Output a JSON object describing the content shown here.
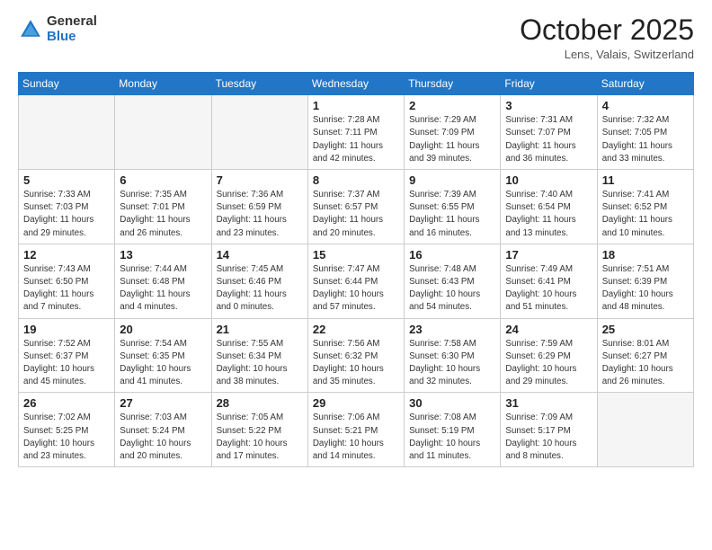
{
  "header": {
    "logo_general": "General",
    "logo_blue": "Blue",
    "month_title": "October 2025",
    "location": "Lens, Valais, Switzerland"
  },
  "weekdays": [
    "Sunday",
    "Monday",
    "Tuesday",
    "Wednesday",
    "Thursday",
    "Friday",
    "Saturday"
  ],
  "weeks": [
    [
      {
        "day": "",
        "info": ""
      },
      {
        "day": "",
        "info": ""
      },
      {
        "day": "",
        "info": ""
      },
      {
        "day": "1",
        "info": "Sunrise: 7:28 AM\nSunset: 7:11 PM\nDaylight: 11 hours\nand 42 minutes."
      },
      {
        "day": "2",
        "info": "Sunrise: 7:29 AM\nSunset: 7:09 PM\nDaylight: 11 hours\nand 39 minutes."
      },
      {
        "day": "3",
        "info": "Sunrise: 7:31 AM\nSunset: 7:07 PM\nDaylight: 11 hours\nand 36 minutes."
      },
      {
        "day": "4",
        "info": "Sunrise: 7:32 AM\nSunset: 7:05 PM\nDaylight: 11 hours\nand 33 minutes."
      }
    ],
    [
      {
        "day": "5",
        "info": "Sunrise: 7:33 AM\nSunset: 7:03 PM\nDaylight: 11 hours\nand 29 minutes."
      },
      {
        "day": "6",
        "info": "Sunrise: 7:35 AM\nSunset: 7:01 PM\nDaylight: 11 hours\nand 26 minutes."
      },
      {
        "day": "7",
        "info": "Sunrise: 7:36 AM\nSunset: 6:59 PM\nDaylight: 11 hours\nand 23 minutes."
      },
      {
        "day": "8",
        "info": "Sunrise: 7:37 AM\nSunset: 6:57 PM\nDaylight: 11 hours\nand 20 minutes."
      },
      {
        "day": "9",
        "info": "Sunrise: 7:39 AM\nSunset: 6:55 PM\nDaylight: 11 hours\nand 16 minutes."
      },
      {
        "day": "10",
        "info": "Sunrise: 7:40 AM\nSunset: 6:54 PM\nDaylight: 11 hours\nand 13 minutes."
      },
      {
        "day": "11",
        "info": "Sunrise: 7:41 AM\nSunset: 6:52 PM\nDaylight: 11 hours\nand 10 minutes."
      }
    ],
    [
      {
        "day": "12",
        "info": "Sunrise: 7:43 AM\nSunset: 6:50 PM\nDaylight: 11 hours\nand 7 minutes."
      },
      {
        "day": "13",
        "info": "Sunrise: 7:44 AM\nSunset: 6:48 PM\nDaylight: 11 hours\nand 4 minutes."
      },
      {
        "day": "14",
        "info": "Sunrise: 7:45 AM\nSunset: 6:46 PM\nDaylight: 11 hours\nand 0 minutes."
      },
      {
        "day": "15",
        "info": "Sunrise: 7:47 AM\nSunset: 6:44 PM\nDaylight: 10 hours\nand 57 minutes."
      },
      {
        "day": "16",
        "info": "Sunrise: 7:48 AM\nSunset: 6:43 PM\nDaylight: 10 hours\nand 54 minutes."
      },
      {
        "day": "17",
        "info": "Sunrise: 7:49 AM\nSunset: 6:41 PM\nDaylight: 10 hours\nand 51 minutes."
      },
      {
        "day": "18",
        "info": "Sunrise: 7:51 AM\nSunset: 6:39 PM\nDaylight: 10 hours\nand 48 minutes."
      }
    ],
    [
      {
        "day": "19",
        "info": "Sunrise: 7:52 AM\nSunset: 6:37 PM\nDaylight: 10 hours\nand 45 minutes."
      },
      {
        "day": "20",
        "info": "Sunrise: 7:54 AM\nSunset: 6:35 PM\nDaylight: 10 hours\nand 41 minutes."
      },
      {
        "day": "21",
        "info": "Sunrise: 7:55 AM\nSunset: 6:34 PM\nDaylight: 10 hours\nand 38 minutes."
      },
      {
        "day": "22",
        "info": "Sunrise: 7:56 AM\nSunset: 6:32 PM\nDaylight: 10 hours\nand 35 minutes."
      },
      {
        "day": "23",
        "info": "Sunrise: 7:58 AM\nSunset: 6:30 PM\nDaylight: 10 hours\nand 32 minutes."
      },
      {
        "day": "24",
        "info": "Sunrise: 7:59 AM\nSunset: 6:29 PM\nDaylight: 10 hours\nand 29 minutes."
      },
      {
        "day": "25",
        "info": "Sunrise: 8:01 AM\nSunset: 6:27 PM\nDaylight: 10 hours\nand 26 minutes."
      }
    ],
    [
      {
        "day": "26",
        "info": "Sunrise: 7:02 AM\nSunset: 5:25 PM\nDaylight: 10 hours\nand 23 minutes."
      },
      {
        "day": "27",
        "info": "Sunrise: 7:03 AM\nSunset: 5:24 PM\nDaylight: 10 hours\nand 20 minutes."
      },
      {
        "day": "28",
        "info": "Sunrise: 7:05 AM\nSunset: 5:22 PM\nDaylight: 10 hours\nand 17 minutes."
      },
      {
        "day": "29",
        "info": "Sunrise: 7:06 AM\nSunset: 5:21 PM\nDaylight: 10 hours\nand 14 minutes."
      },
      {
        "day": "30",
        "info": "Sunrise: 7:08 AM\nSunset: 5:19 PM\nDaylight: 10 hours\nand 11 minutes."
      },
      {
        "day": "31",
        "info": "Sunrise: 7:09 AM\nSunset: 5:17 PM\nDaylight: 10 hours\nand 8 minutes."
      },
      {
        "day": "",
        "info": ""
      }
    ]
  ]
}
